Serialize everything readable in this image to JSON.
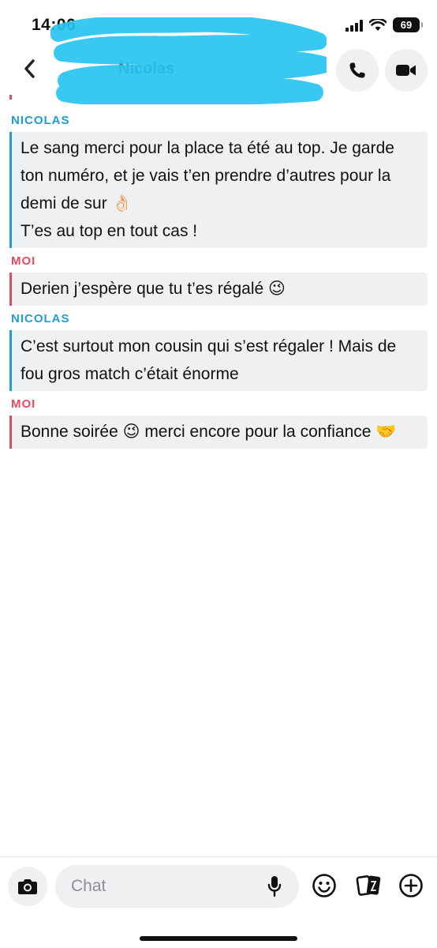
{
  "status_bar": {
    "time": "14:06",
    "battery": "69"
  },
  "header": {
    "contact_name": "Nicolas",
    "back_icon": "chevron-left-icon",
    "call_icon": "phone-icon",
    "video_icon": "video-camera-icon"
  },
  "messages": [
    {
      "sender": "NICOLAS",
      "type": "nicolas",
      "text": "Le sang merci pour la place ta été au top. Je garde ton numéro, et je vais t’en prendre d’autres pour la demi de sur 👌🏻\nT’es au top en tout cas !"
    },
    {
      "sender": "MOI",
      "type": "moi",
      "text": "Derien j’espère que tu t’es régalé 😉"
    },
    {
      "sender": "NICOLAS",
      "type": "nicolas",
      "text": "C’est surtout mon cousin qui s’est régaler ! Mais de fou gros match c’était énorme"
    },
    {
      "sender": "MOI",
      "type": "moi",
      "text": "Bonne soirée 😉 merci encore pour la confiance 🤝"
    }
  ],
  "composer": {
    "placeholder": "Chat",
    "camera_icon": "camera-icon",
    "mic_icon": "microphone-icon",
    "smile_icon": "smiley-icon",
    "cards_icon": "cards-icon",
    "plus_icon": "plus-circle-icon"
  },
  "colors": {
    "nicolas": "#1e9dd8",
    "moi": "#e94a63",
    "bubble_bg": "#eef0f2",
    "scribble": "#27c3f0"
  }
}
